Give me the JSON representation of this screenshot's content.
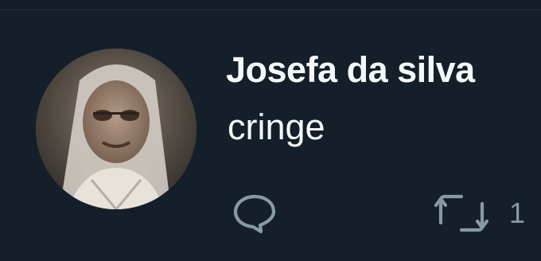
{
  "tweet": {
    "display_name": "Josefa da silva",
    "text": "cringe",
    "retweet_count": "1"
  },
  "icons": {
    "avatar": "profile-photo",
    "reply": "speech-bubble-icon",
    "retweet": "retweet-arrows-icon"
  },
  "colors": {
    "background": "#141f2a",
    "text": "#f5f8fa",
    "muted": "#8899a6"
  }
}
